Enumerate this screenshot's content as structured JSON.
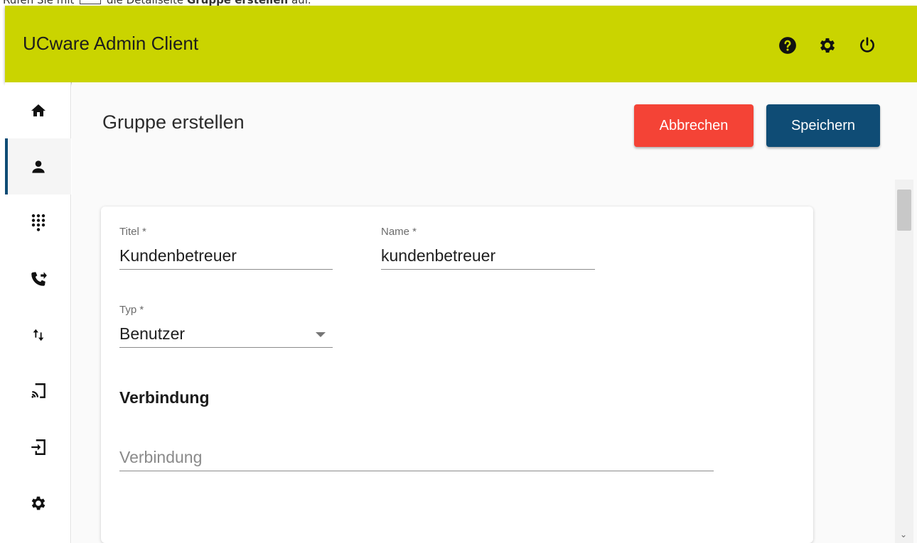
{
  "caption": {
    "prefix": "Rufen Sie mit",
    "middle": "die Detailseite",
    "bold": "Gruppe erstellen",
    "suffix": "auf."
  },
  "app": {
    "title": "UCware Admin Client"
  },
  "header_icons": [
    "help-icon",
    "settings-icon",
    "power-icon"
  ],
  "sidebar": {
    "items": [
      {
        "icon": "home-icon",
        "active": false
      },
      {
        "icon": "user-icon",
        "active": true
      },
      {
        "icon": "dialpad-icon",
        "active": false
      },
      {
        "icon": "call-forward-icon",
        "active": false
      },
      {
        "icon": "swap-vert-icon",
        "active": false
      },
      {
        "icon": "cast-icon",
        "active": false
      },
      {
        "icon": "login-icon",
        "active": false
      },
      {
        "icon": "settings-icon",
        "active": false
      }
    ]
  },
  "page": {
    "title": "Gruppe erstellen",
    "cancel_label": "Abbrechen",
    "save_label": "Speichern"
  },
  "form": {
    "titel": {
      "label": "Titel *",
      "value": "Kundenbetreuer"
    },
    "name": {
      "label": "Name *",
      "value": "kundenbetreuer"
    },
    "typ": {
      "label": "Typ *",
      "value": "Benutzer"
    },
    "section_title": "Verbindung",
    "verbindung": {
      "placeholder": "Verbindung"
    }
  },
  "colors": {
    "header": "#cad400",
    "cancel": "#f44336",
    "save": "#0f4c75",
    "active_indicator": "#0f4c75"
  }
}
